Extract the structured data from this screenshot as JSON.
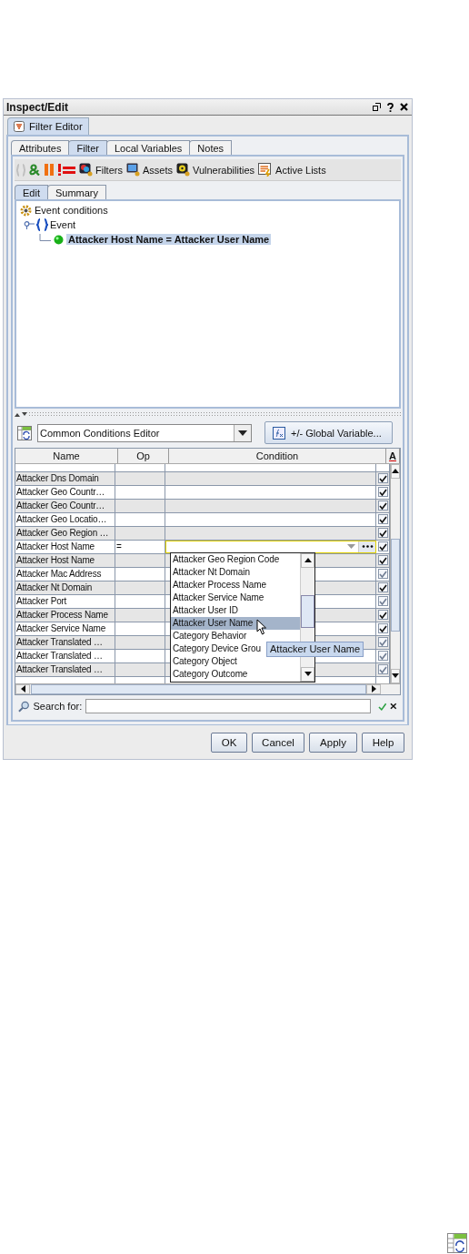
{
  "window": {
    "title": "Inspect/Edit"
  },
  "outer_tab": {
    "label": "Filter Editor",
    "selected": true
  },
  "tabs": [
    {
      "label": "Attributes",
      "selected": false
    },
    {
      "label": "Filter",
      "selected": true
    },
    {
      "label": "Local Variables",
      "selected": false
    },
    {
      "label": "Notes",
      "selected": false
    }
  ],
  "toolbar": [
    {
      "kind": "braces",
      "disabled": true
    },
    {
      "kind": "and",
      "disabled": false
    },
    {
      "kind": "or",
      "disabled": false
    },
    {
      "kind": "not",
      "disabled": false
    },
    {
      "kind": "filters",
      "label": "Filters",
      "disabled": false
    },
    {
      "kind": "assets",
      "label": "Assets",
      "disabled": false
    },
    {
      "kind": "vulnerabilities",
      "label": "Vulnerabilities",
      "disabled": false
    },
    {
      "kind": "lists",
      "label": "Active Lists",
      "disabled": false
    }
  ],
  "subtabs": [
    {
      "label": "Edit",
      "selected": true
    },
    {
      "label": "Summary",
      "selected": false
    }
  ],
  "tree": {
    "label": "Event conditions",
    "children": [
      {
        "label": "Event",
        "expanded": true,
        "children": [
          {
            "label": "Attacker Host Name = Attacker User Name",
            "selected": true
          }
        ]
      }
    ]
  },
  "editor_select": {
    "value": "Common Conditions Editor"
  },
  "global_button": "+/- Global Variable...",
  "table": {
    "columns": [
      "Name",
      "Op",
      "Condition",
      "A"
    ],
    "rows": [
      {
        "name": "Attacker Dns Domain",
        "checked": true,
        "disabled": false
      },
      {
        "name": "Attacker Geo Countr…",
        "checked": true,
        "disabled": false
      },
      {
        "name": "Attacker Geo Countr…",
        "checked": true,
        "disabled": false
      },
      {
        "name": "Attacker Geo Locatio…",
        "checked": true,
        "disabled": false
      },
      {
        "name": "Attacker Geo Region …",
        "checked": true,
        "disabled": false
      },
      {
        "name": "Attacker Host Name",
        "op": "=",
        "editing": true,
        "checked": true,
        "disabled": false
      },
      {
        "name": "Attacker Host Name",
        "checked": true,
        "disabled": false
      },
      {
        "name": "Attacker Mac Address",
        "checked": true,
        "disabled": true
      },
      {
        "name": "Attacker Nt Domain",
        "checked": true,
        "disabled": false
      },
      {
        "name": "Attacker Port",
        "checked": true,
        "disabled": true
      },
      {
        "name": "Attacker Process Name",
        "checked": true,
        "disabled": false
      },
      {
        "name": "Attacker Service Name",
        "checked": true,
        "disabled": false
      },
      {
        "name": "Attacker Translated …",
        "checked": true,
        "disabled": true
      },
      {
        "name": "Attacker Translated …",
        "checked": true,
        "disabled": true
      },
      {
        "name": "Attacker Translated …",
        "checked": true,
        "disabled": true
      }
    ]
  },
  "dropdown": {
    "items": [
      {
        "label": "Attacker Geo Region Code",
        "selected": false
      },
      {
        "label": "Attacker Nt Domain",
        "selected": false
      },
      {
        "label": "Attacker Process Name",
        "selected": false
      },
      {
        "label": "Attacker Service Name",
        "selected": false
      },
      {
        "label": "Attacker User ID",
        "selected": false
      },
      {
        "label": "Attacker User Name",
        "selected": true
      },
      {
        "label": "Category Behavior",
        "selected": false
      },
      {
        "label": "Category Device Grou",
        "selected": false
      },
      {
        "label": "Category Object",
        "selected": false
      },
      {
        "label": "Category Outcome",
        "selected": false
      }
    ]
  },
  "tooltip": "Attacker User Name",
  "search": {
    "label": "Search for:"
  },
  "buttons": [
    "OK",
    "Cancel",
    "Apply",
    "Help"
  ]
}
